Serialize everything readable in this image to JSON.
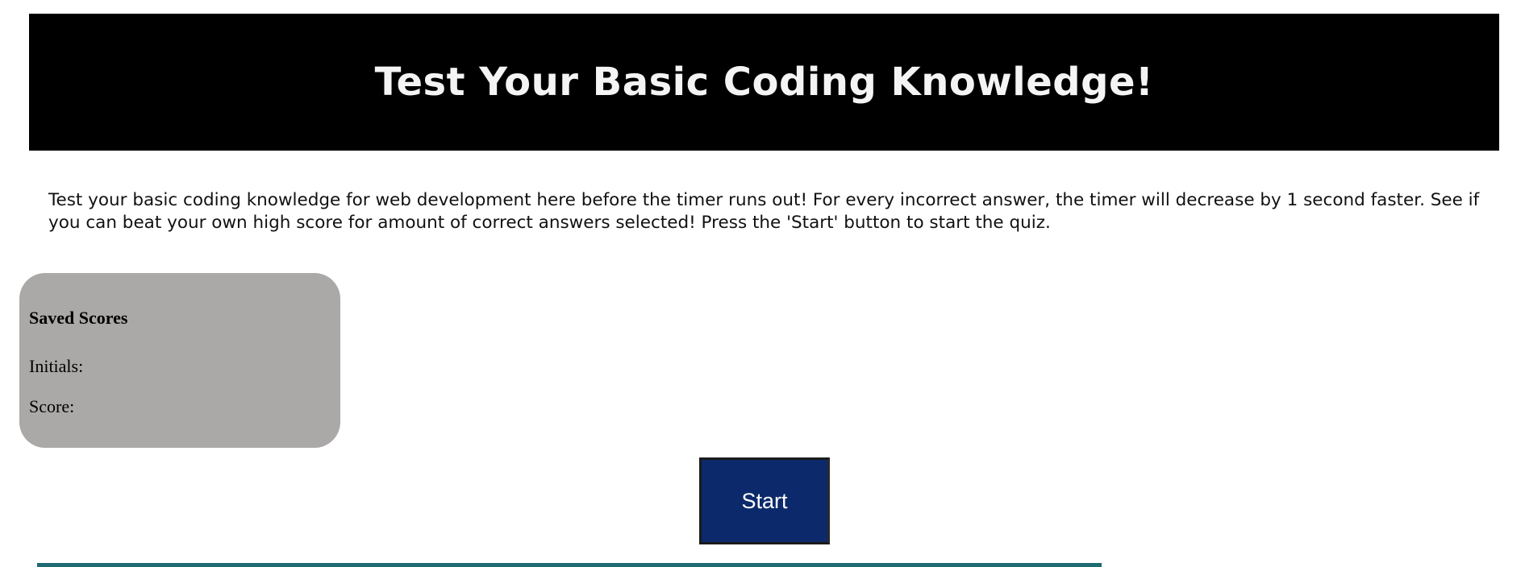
{
  "header": {
    "title": "Test Your Basic Coding Knowledge!"
  },
  "intro": {
    "text": "Test your basic coding knowledge for web development here before the timer runs out! For every incorrect answer, the timer will decrease by 1 second faster. See if you can beat your own high score for amount of correct answers selected! Press the 'Start' button to start the quiz."
  },
  "saved_scores": {
    "title": "Saved Scores",
    "initials_label": "Initials:",
    "score_label": "Score:"
  },
  "start_button": {
    "label": "Start"
  },
  "colors": {
    "header_bg": "#000000",
    "scores_panel_bg": "#aaa9a8",
    "start_button_bg": "#0c2a6b",
    "divider": "#1e6b73"
  }
}
